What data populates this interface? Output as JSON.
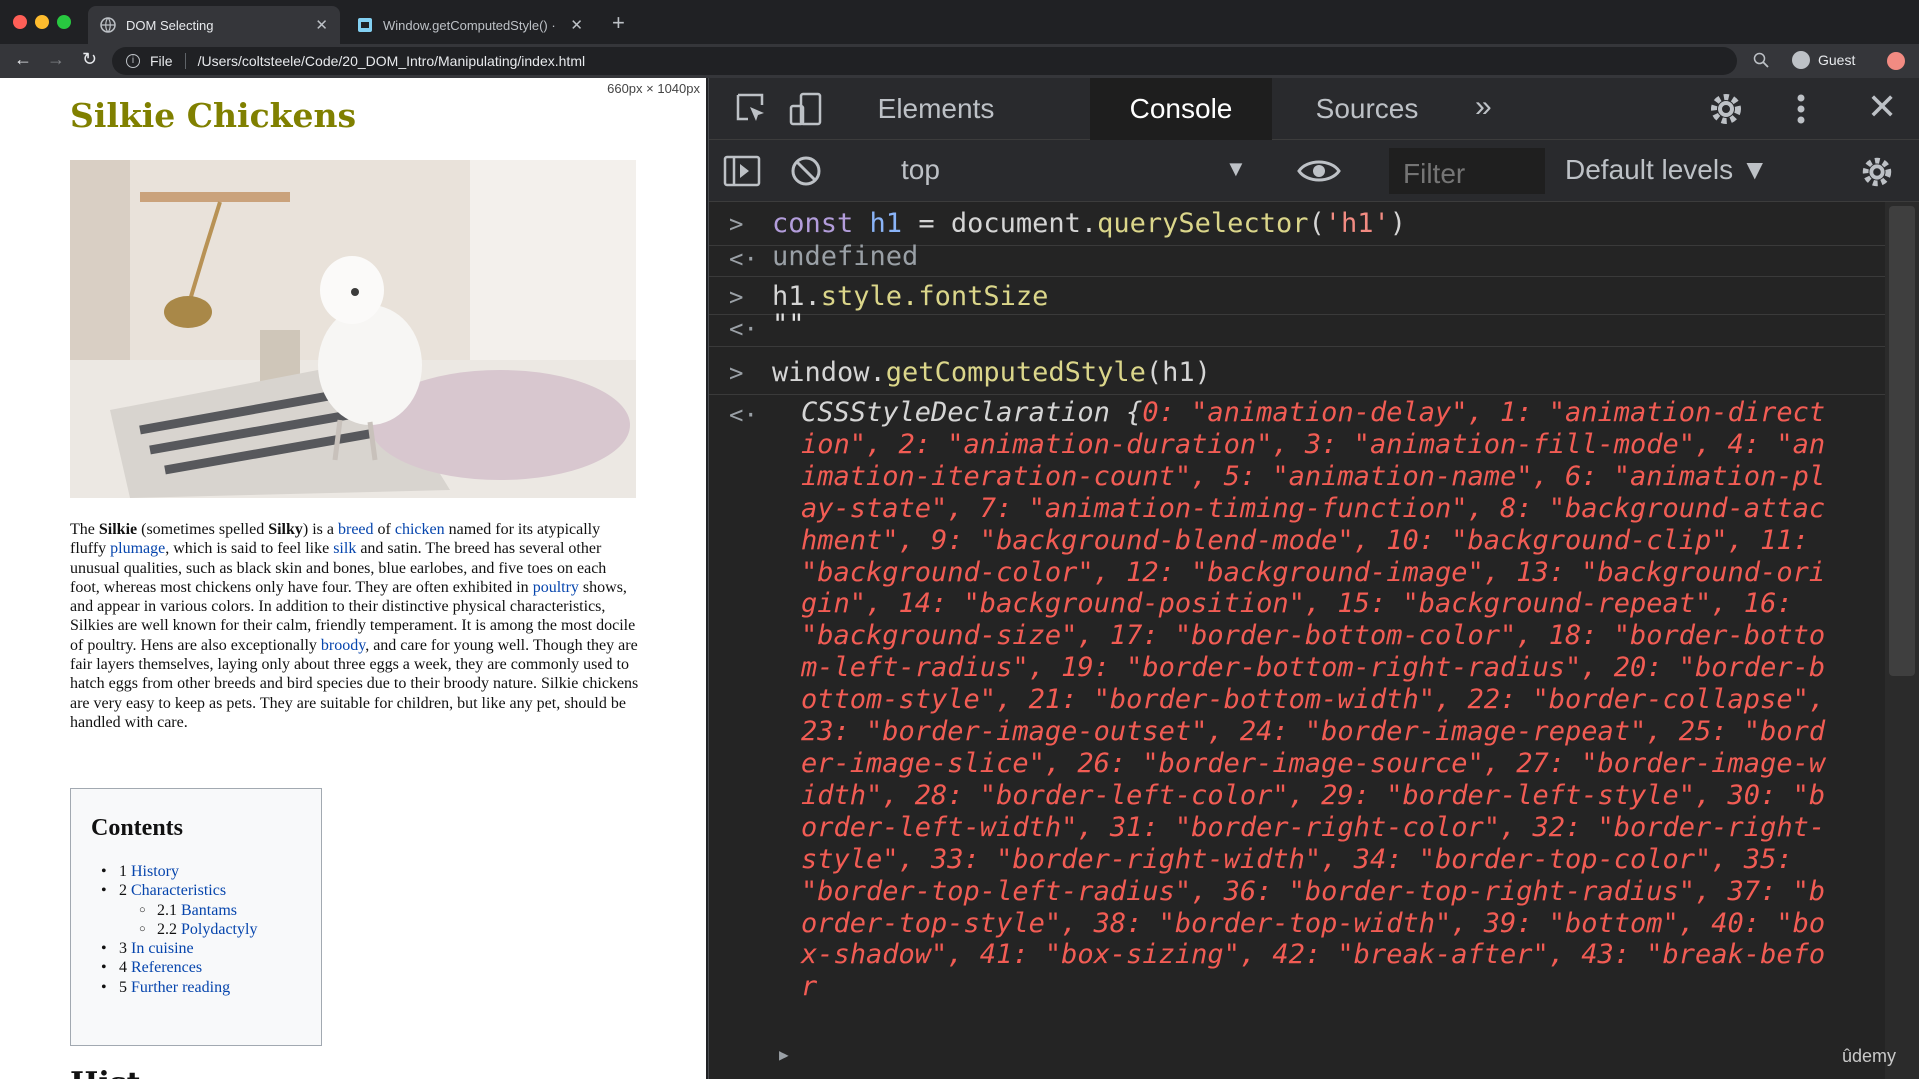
{
  "browser": {
    "tabs": [
      {
        "title": "DOM Selecting",
        "active": true
      },
      {
        "title": "Window.getComputedStyle() ·",
        "active": false
      }
    ],
    "address": {
      "scheme": "File",
      "url": "/Users/coltsteele/Code/20_DOM_Intro/Manipulating/index.html"
    },
    "profile": "Guest"
  },
  "page": {
    "dimensions": "660px × 1040px",
    "title": "Silkie Chickens",
    "paragraph": {
      "p1": "The ",
      "silkie": "Silkie",
      "p2": " (sometimes spelled ",
      "silky": "Silky",
      "p3": ") is a ",
      "breed": "breed",
      "p4": " of ",
      "chicken": "chicken",
      "p5": " named for its atypically fluffy ",
      "plumage": "plumage",
      "p6": ", which is said to feel like ",
      "silk": "silk",
      "p7": " and satin. The breed has several other unusual qualities, such as black skin and bones, blue earlobes, and five toes on each foot, whereas most chickens only have four. They are often exhibited in ",
      "poultry": "poultry",
      "p8": " shows, and appear in various colors. In addition to their distinctive physical characteristics, Silkies are well known for their calm, friendly temperament. It is among the most docile of poultry. Hens are also exceptionally ",
      "broody": "broody",
      "p9": ", and care for young well. Though they are fair layers themselves, laying only about three eggs a week, they are commonly used to hatch eggs from other breeds and bird species due to their broody nature. Silkie chickens are very easy to keep as pets. They are suitable for children, but like any pet, should be handled with care."
    },
    "toc": {
      "title": "Contents",
      "items": [
        {
          "num": "1",
          "label": "History"
        },
        {
          "num": "2",
          "label": "Characteristics"
        },
        {
          "num": "2.1",
          "label": "Bantams"
        },
        {
          "num": "2.2",
          "label": "Polydactyly"
        },
        {
          "num": "3",
          "label": "In cuisine"
        },
        {
          "num": "4",
          "label": "References"
        },
        {
          "num": "5",
          "label": "Further reading"
        }
      ]
    },
    "next_heading": "Hist"
  },
  "devtools": {
    "tabs": [
      "Elements",
      "Console",
      "Sources"
    ],
    "more": "»",
    "context": "top",
    "filter_placeholder": "Filter",
    "levels": "Default levels ▼",
    "console": {
      "cmd1": {
        "kw": "const",
        "var": "h1",
        "eq": " = document.",
        "fn": "querySelector",
        "open": "(",
        "str": "'h1'",
        "close": ")"
      },
      "out1": "undefined",
      "cmd2": {
        "obj": "h1.",
        "fn": "style.fontSize"
      },
      "out2": "\"\"",
      "cmd3": {
        "obj": "window.",
        "fn": "getComputedStyle",
        "args": "(h1)"
      },
      "out3_lead": "CSSStyleDeclaration {",
      "out3_body": "0: \"animation-delay\", 1: \"animation-direction\", 2: \"animation-duration\", 3: \"animation-fill-mode\", 4: \"animation-iteration-count\", 5: \"animation-name\", 6: \"animation-play-state\", 7: \"animation-timing-function\", 8: \"background-attachment\", 9: \"background-blend-mode\", 10: \"background-clip\", 11: \"background-color\", 12: \"background-image\", 13: \"background-origin\", 14: \"background-position\", 15: \"background-repeat\", 16: \"background-size\", 17: \"border-bottom-color\", 18: \"border-bottom-left-radius\", 19: \"border-bottom-right-radius\", 20: \"border-bottom-style\", 21: \"border-bottom-width\", 22: \"border-collapse\", 23: \"border-image-outset\", 24: \"border-image-repeat\", 25: \"border-image-slice\", 26: \"border-image-source\", 27: \"border-image-width\", 28: \"border-left-color\", 29: \"border-left-style\", 30: \"border-left-width\", 31: \"border-right-color\", 32: \"border-right-style\", 33: \"border-right-width\", 34: \"border-top-color\", 35: \"border-top-left-radius\", 36: \"border-top-right-radius\", 37: \"border-top-style\", 38: \"border-top-width\", 39: \"bottom\", 40: \"box-shadow\", 41: \"box-sizing\", 42: \"break-after\", 43: \"break-befor"
    }
  },
  "watermark": "ûdemy",
  "colors": {
    "title_olive": "#808000",
    "link_blue": "#0645ad",
    "console_string": "#f28b82",
    "console_function": "#dbd68a",
    "console_keyword": "#b39ddb"
  }
}
